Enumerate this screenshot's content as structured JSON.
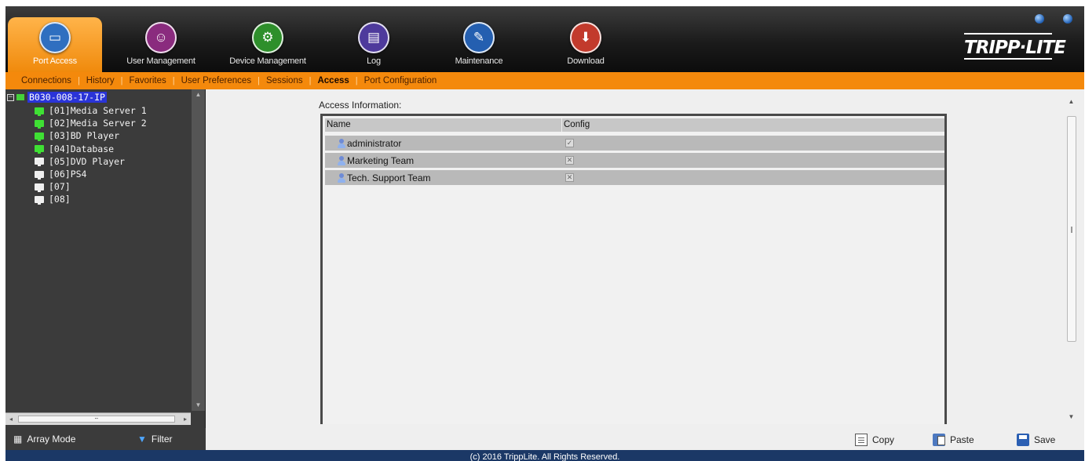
{
  "nav_tabs": [
    {
      "label": "Port Access",
      "icon": "monitor-icon",
      "color": "#2f6fc0",
      "active": true
    },
    {
      "label": "User Management",
      "icon": "users-icon",
      "color": "#8a2b7e",
      "active": false
    },
    {
      "label": "Device Management",
      "icon": "device-icon",
      "color": "#2e8f2b",
      "active": false
    },
    {
      "label": "Log",
      "icon": "log-icon",
      "color": "#4e3a9c",
      "active": false
    },
    {
      "label": "Maintenance",
      "icon": "maintenance-icon",
      "color": "#245fb0",
      "active": false
    },
    {
      "label": "Download",
      "icon": "download-icon",
      "color": "#c23a2c",
      "active": false
    }
  ],
  "logo": {
    "text": "TRIPP·LITE"
  },
  "sub_nav": [
    {
      "label": "Connections",
      "active": false
    },
    {
      "label": "History",
      "active": false
    },
    {
      "label": "Favorites",
      "active": false
    },
    {
      "label": "User Preferences",
      "active": false
    },
    {
      "label": "Sessions",
      "active": false
    },
    {
      "label": "Access",
      "active": true
    },
    {
      "label": "Port Configuration",
      "active": false
    }
  ],
  "tree": {
    "root_label": "B030-008-17-IP",
    "ports": [
      {
        "label": "[01]Media Server 1",
        "status": "on"
      },
      {
        "label": "[02]Media Server 2",
        "status": "on"
      },
      {
        "label": "[03]BD Player",
        "status": "on"
      },
      {
        "label": "[04]Database",
        "status": "on"
      },
      {
        "label": "[05]DVD Player",
        "status": "off"
      },
      {
        "label": "[06]PS4",
        "status": "off"
      },
      {
        "label": "[07]",
        "status": "off"
      },
      {
        "label": "[08]",
        "status": "off"
      }
    ]
  },
  "array_bar": {
    "array_mode_label": "Array Mode",
    "filter_label": "Filter"
  },
  "access": {
    "title": "Access Information:",
    "columns": {
      "name": "Name",
      "config": "Config"
    },
    "rows": [
      {
        "name": "administrator",
        "config": "✓"
      },
      {
        "name": "Marketing Team",
        "config": "✕"
      },
      {
        "name": "Tech. Support Team",
        "config": "✕"
      }
    ]
  },
  "actions": {
    "copy_label": "Copy",
    "paste_label": "Paste",
    "save_label": "Save"
  },
  "footer": {
    "text": "(c) 2016 TrippLite. All Rights Reserved."
  },
  "colors": {
    "accent_orange": "#f4890c",
    "footer_blue": "#1b3866",
    "tree_bg": "#3b3b3b"
  }
}
